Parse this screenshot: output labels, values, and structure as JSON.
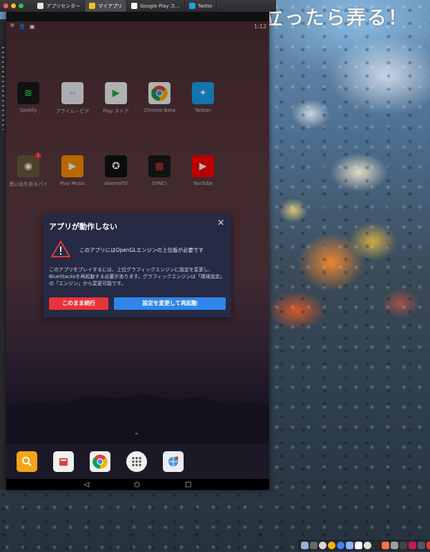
{
  "desktop": {
    "overlay_title": "思い立ったら弄る！"
  },
  "window": {
    "tabs": [
      {
        "label": "アプリセンター",
        "color": "#e8e8e8",
        "active": false
      },
      {
        "label": "マイアプリ",
        "color": "#f2c21b",
        "active": true
      },
      {
        "label": "Google Play ス…",
        "color": "#ffffff",
        "active": false
      },
      {
        "label": "Twitte",
        "color": "#1da1f2",
        "active": false
      }
    ]
  },
  "status_bar": {
    "time": "1:12",
    "icons": [
      "shield-icon",
      "person-add-icon",
      "android-icon"
    ]
  },
  "apps": [
    {
      "label": "Spotify",
      "color": "#1ed760",
      "bg": "#1a1a1a",
      "glyph": "≋",
      "icon": "spotify-icon"
    },
    {
      "label": "プライム・ビデ",
      "color": "#ffffff",
      "bg": "#eef1f5",
      "glyph": "▭",
      "icon": "prime-video-icon"
    },
    {
      "label": "Play ストア",
      "color": "#34a853",
      "bg": "#ffffff",
      "glyph": "▶",
      "icon": "play-store-icon"
    },
    {
      "label": "Chrome Beta",
      "color": "#ffffff",
      "bg": "#ffffff",
      "glyph": "◎",
      "icon": "chrome-beta-icon"
    },
    {
      "label": "Twitter",
      "color": "#ffffff",
      "bg": "#1da1f2",
      "glyph": "✦",
      "icon": "twitter-icon"
    },
    {
      "label": "思い出を巡るパイ",
      "color": "#ffffff",
      "bg": "#6b5a3a",
      "glyph": "◉",
      "icon": "game-app-icon",
      "badge": "1"
    },
    {
      "label": "Play Music",
      "color": "#ffffff",
      "bg": "#ff8f00",
      "glyph": "▶",
      "icon": "play-music-icon"
    },
    {
      "label": "AbemaTV",
      "color": "#ffffff",
      "bg": "#111111",
      "glyph": "✪",
      "icon": "abematv-icon"
    },
    {
      "label": "SYNC!",
      "color": "#e53935",
      "bg": "#1a1a1a",
      "glyph": "▦",
      "icon": "sync-app-icon"
    },
    {
      "label": "YouTube",
      "color": "#ffffff",
      "bg": "#ff0000",
      "glyph": "▶",
      "icon": "youtube-icon"
    }
  ],
  "dialog": {
    "title": "アプリが動作しない",
    "close": "✕",
    "warning": "このアプリにはOpenGLエンジンの上位版が必要です",
    "body": "このアプリをプレイするには、上位グラフィックエンジンに設定を変更し、BlueStacksを再起動する必要があります。グラフィックエンジンは「環境設定」の「エンジン」から変更可能です。",
    "continue_label": "このまま続行",
    "restart_label": "設定を変更して再起動"
  },
  "dock": {
    "apps": [
      "search-app-icon",
      "folder-app-icon",
      "chrome-icon",
      "app-drawer-icon",
      "browser-icon"
    ]
  },
  "navbar": {
    "back": "◁",
    "home": "○",
    "recents": "□"
  },
  "colors": {
    "dialog_bg": "#262a45",
    "continue_button": "#e8333a",
    "restart_button": "#2f86ea"
  }
}
